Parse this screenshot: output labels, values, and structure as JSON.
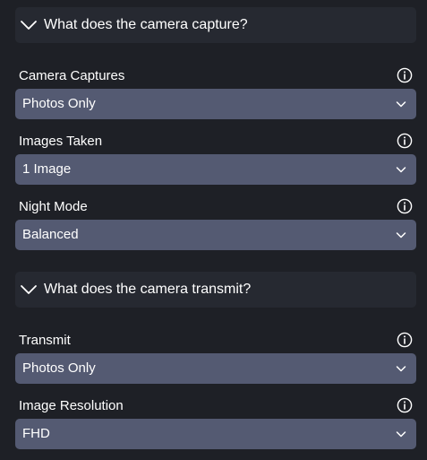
{
  "sections": [
    {
      "title": "What does the camera capture?",
      "fields": [
        {
          "label": "Camera Captures",
          "value": "Photos Only"
        },
        {
          "label": "Images Taken",
          "value": "1 Image"
        },
        {
          "label": "Night Mode",
          "value": "Balanced"
        }
      ]
    },
    {
      "title": "What does the camera transmit?",
      "fields": [
        {
          "label": "Transmit",
          "value": "Photos Only"
        },
        {
          "label": "Image Resolution",
          "value": "FHD"
        }
      ]
    }
  ],
  "icons": {
    "section_toggle": "chevron-down-icon",
    "field_info": "info-icon",
    "select_caret": "caret-down-icon"
  },
  "colors": {
    "background": "#1e2026",
    "section_header_bg": "#262931",
    "select_bg": "#545a72",
    "text": "#ffffff"
  }
}
